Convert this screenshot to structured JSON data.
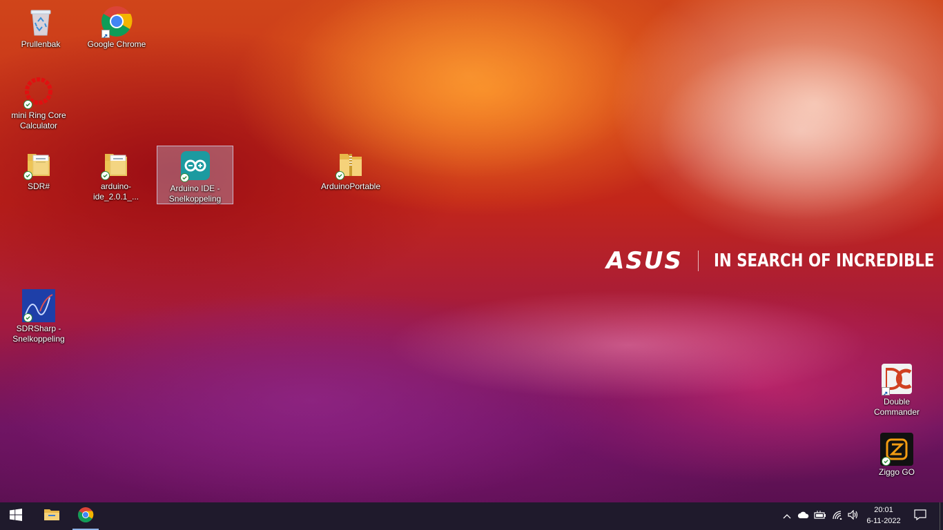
{
  "desktop": {
    "icons": [
      {
        "id": "recycle-bin",
        "label": "Prullenbak"
      },
      {
        "id": "chrome",
        "label": "Google Chrome"
      },
      {
        "id": "ring-core",
        "label": "mini Ring Core\nCalculator"
      },
      {
        "id": "sdr",
        "label": "SDR#"
      },
      {
        "id": "arduino-zip-folder",
        "label": "arduino-ide_2.0.1_..."
      },
      {
        "id": "arduino-ide",
        "label": "Arduino IDE -\nSnelkoppeling"
      },
      {
        "id": "arduino-portable",
        "label": "ArduinoPortable"
      },
      {
        "id": "sdrsharp",
        "label": "SDRSharp -\nSnelkoppeling"
      },
      {
        "id": "double-commander",
        "label": "Double Commander"
      },
      {
        "id": "ziggo-go",
        "label": "Ziggo GO"
      }
    ]
  },
  "wallpaper": {
    "brand": "ASUS",
    "slogan": "IN SEARCH OF INCREDIBLE"
  },
  "taskbar": {
    "start_icon": "windows-logo-icon",
    "pinned": [
      {
        "id": "file-explorer",
        "icon": "folder-icon"
      },
      {
        "id": "chrome",
        "icon": "chrome-icon",
        "active": true
      }
    ],
    "tray": {
      "icons": [
        "chevron-up-icon",
        "onedrive-cloud-icon",
        "battery-icon",
        "wifi-icon",
        "speaker-icon"
      ],
      "time": "20:01",
      "date": "6-11-2022",
      "notification_icon": "action-center-icon"
    }
  },
  "colors": {
    "taskbar_bg": "#1f1a2c",
    "selection_bg": "rgba(190,200,230,0.35)",
    "sync_green": "#2e8b3a"
  }
}
